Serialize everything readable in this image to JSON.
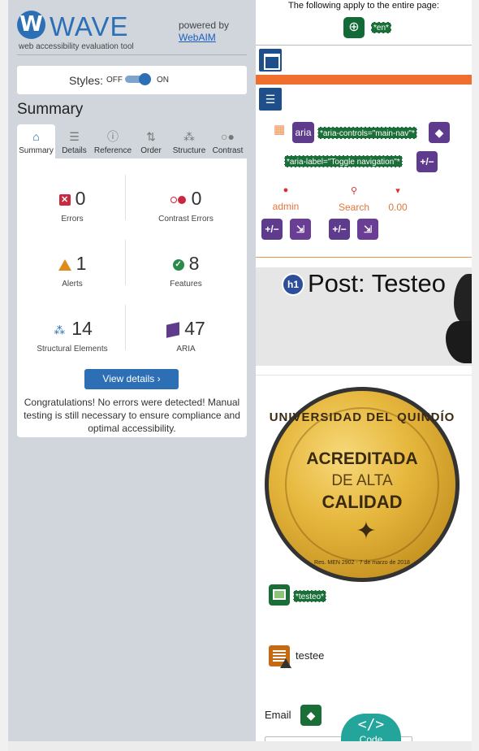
{
  "wave": {
    "logo_letter": "W",
    "logo_word": "WAVE",
    "logo_subtitle": "web accessibility evaluation tool",
    "powered_by": "powered by",
    "webaim": "WebAIM",
    "styles_label": "Styles:",
    "styles_off": "OFF",
    "styles_on": "ON",
    "styles_state": "on",
    "summary_title": "Summary",
    "tabs": [
      {
        "label": "Summary",
        "icon": "home-icon",
        "active": true
      },
      {
        "label": "Details",
        "icon": "list-icon"
      },
      {
        "label": "Reference",
        "icon": "info-icon"
      },
      {
        "label": "Order",
        "icon": "order-icon"
      },
      {
        "label": "Structure",
        "icon": "structure-icon"
      },
      {
        "label": "Contrast",
        "icon": "contrast-icon"
      }
    ],
    "stats": {
      "errors": {
        "value": "0",
        "label": "Errors"
      },
      "contrast": {
        "value": "0",
        "label": "Contrast Errors"
      },
      "alerts": {
        "value": "1",
        "label": "Alerts"
      },
      "features": {
        "value": "8",
        "label": "Features"
      },
      "structural": {
        "value": "14",
        "label": "Structural Elements"
      },
      "aria": {
        "value": "47",
        "label": "ARIA"
      }
    },
    "view_details": "View details ›",
    "congrats": "Congratulations! No errors were detected! Manual testing is still necessary to ensure compliance and optimal accessibility."
  },
  "page": {
    "applies_text": "The following apply to the entire page:",
    "lang_tag": "*en*",
    "aria_icon_text": "aria",
    "aria_controls_tag": "*aria-controls=\"main-nav\"*",
    "aria_label_tag": "*aria-label=\"Toggle navigation\"*",
    "plus_minus": "+/−",
    "nav_links": [
      {
        "label": "admin",
        "icon": "user-icon"
      },
      {
        "label": "Search",
        "icon": "search-icon"
      },
      {
        "label": "0.00",
        "icon": "cart-icon"
      }
    ],
    "h1_badge": "h1",
    "post_title": "Post: Testeo",
    "medal": {
      "arc": "UNIVERSIDAD DEL QUINDÍO",
      "line1": "ACREDITADA",
      "line2": "DE ALTA",
      "line3": "CALIDAD",
      "footer": "Res. MEN 2902 · 7 de marzo de 2018"
    },
    "alt_tag": "*testeo*",
    "text_label": "testee",
    "email_label": "Email"
  },
  "code_button": {
    "glyph": "</>",
    "label": "Code"
  },
  "colors": {
    "wave_blue": "#2d6fb5",
    "panel_bg": "#d1d6dd",
    "error_red": "#c9283e",
    "alert_orange": "#e08b19",
    "feature_green": "#2a8a4a",
    "aria_purple": "#5e3b8d",
    "code_teal": "#24a59b",
    "nav_orange": "#ef6f2e"
  }
}
